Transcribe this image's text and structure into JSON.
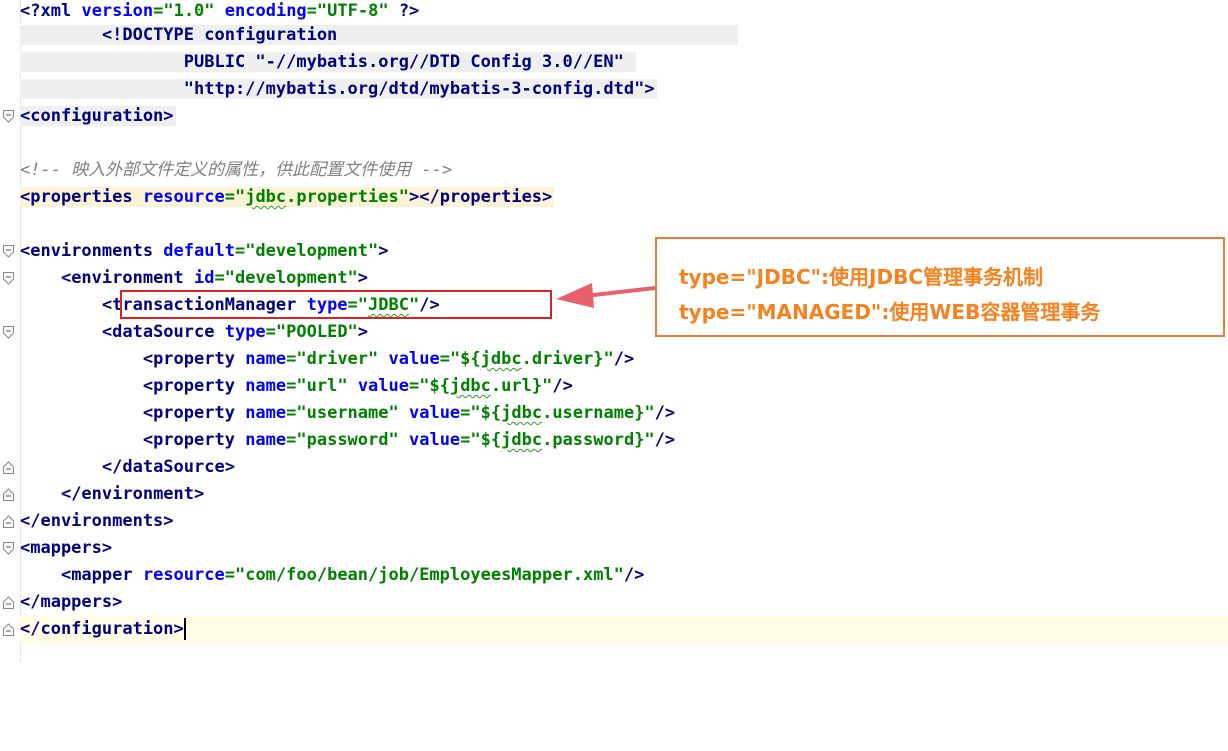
{
  "editor": {
    "lines": [
      {
        "text": "<?xml version=\"1.0\" encoding=\"UTF-8\" ?>"
      },
      {
        "text": "        <!DOCTYPE configuration"
      },
      {
        "text": "                PUBLIC \"-//mybatis.org//DTD Config 3.0//EN\""
      },
      {
        "text": "                \"http://mybatis.org/dtd/mybatis-3-config.dtd\">"
      },
      {
        "text": "<configuration>"
      },
      {
        "text": ""
      },
      {
        "text": "<!-- 映入外部文件定义的属性，供此配置文件使用 -->"
      },
      {
        "text": "<properties resource=\"jdbc.properties\"></properties>"
      },
      {
        "text": ""
      },
      {
        "text": "<environments default=\"development\">"
      },
      {
        "text": "    <environment id=\"development\">"
      },
      {
        "text": "        <transactionManager type=\"JDBC\"/>"
      },
      {
        "text": "        <dataSource type=\"POOLED\">"
      },
      {
        "text": "            <property name=\"driver\" value=\"${jdbc.driver}\"/>"
      },
      {
        "text": "            <property name=\"url\" value=\"${jdbc.url}\"/>"
      },
      {
        "text": "            <property name=\"username\" value=\"${jdbc.username}\"/>"
      },
      {
        "text": "            <property name=\"password\" value=\"${jdbc.password}\"/>"
      },
      {
        "text": "        </dataSource>"
      },
      {
        "text": "    </environment>"
      },
      {
        "text": "</environments>"
      },
      {
        "text": "<mappers>"
      },
      {
        "text": "    <mapper resource=\"com/foo/bean/job/EmployeesMapper.xml\"/>"
      },
      {
        "text": "</mappers>"
      },
      {
        "text": "</configuration>"
      }
    ]
  },
  "annotation": {
    "line1": "type=\"JDBC\":使用JDBC管理事务机制",
    "line2": "type=\"MANAGED\":使用WEB容器管理事务"
  },
  "colors": {
    "tag": "#000080",
    "attribute": "#0000ff",
    "value": "#008000",
    "comment": "#808080",
    "highlight_box": "#e02020",
    "callout": "#f5821f"
  }
}
